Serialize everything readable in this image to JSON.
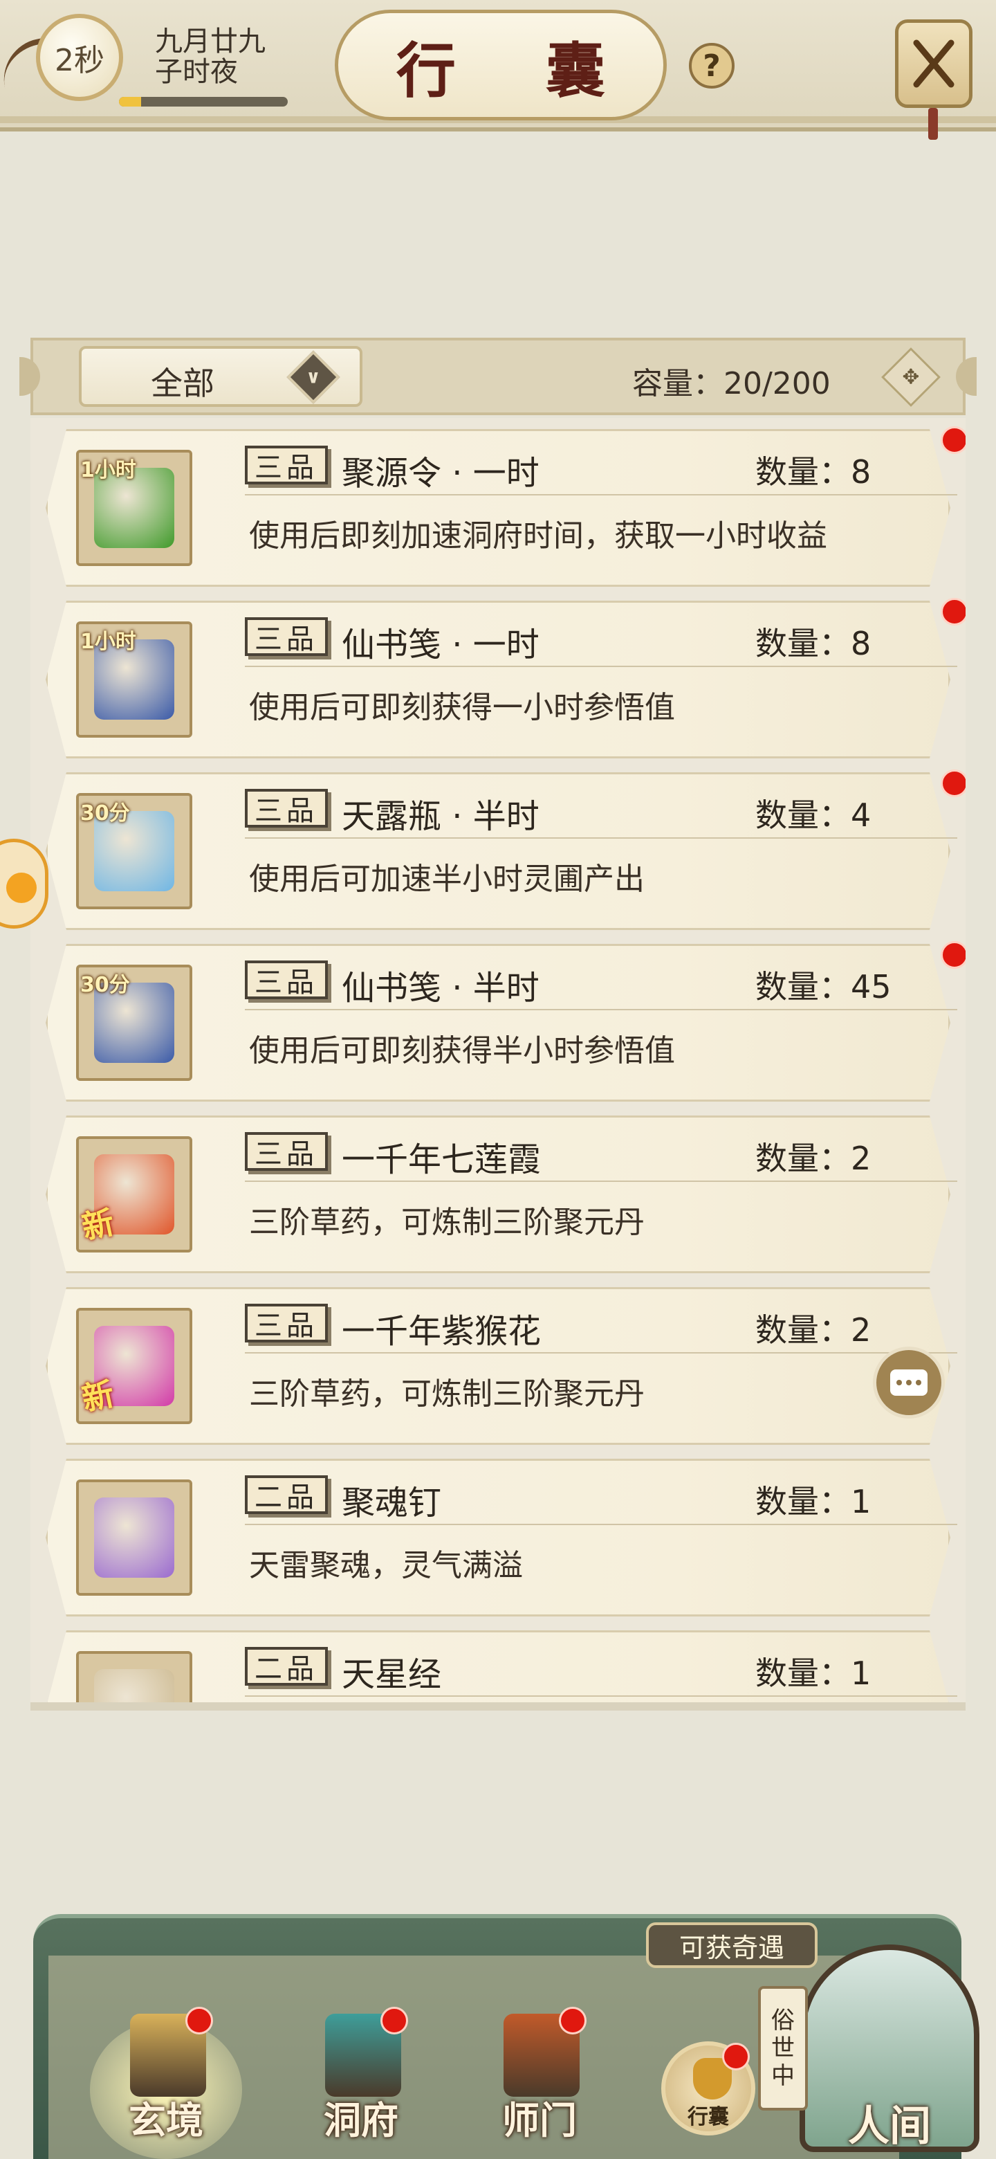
{
  "header": {
    "timer": "2秒",
    "date_line1": "九月廿九",
    "date_line2": "子时夜",
    "time_progress": 0.13,
    "title": "行 囊",
    "help": "?"
  },
  "filter": {
    "category": "全部",
    "capacity": "容量：20/200"
  },
  "items": [
    {
      "tag": "1小时",
      "grade": "三品",
      "name": "聚源令 · 一时",
      "qty": "数量：8",
      "desc": "使用后即刻加速洞府时间，获取一小时收益",
      "art": "green-token-icon",
      "art_color": "#3f9a2a",
      "new": "",
      "dot": true
    },
    {
      "tag": "1小时",
      "grade": "三品",
      "name": "仙书笺 · 一时",
      "qty": "数量：8",
      "desc": "使用后可即刻获得一小时参悟值",
      "art": "scroll-book-icon",
      "art_color": "#3a5aa8",
      "new": "",
      "dot": true
    },
    {
      "tag": "30分",
      "grade": "三品",
      "name": "天露瓶 · 半时",
      "qty": "数量：4",
      "desc": "使用后可加速半小时灵圃产出",
      "art": "dew-vase-icon",
      "art_color": "#6fb6e4",
      "new": "",
      "dot": true
    },
    {
      "tag": "30分",
      "grade": "三品",
      "name": "仙书笺 · 半时",
      "qty": "数量：45",
      "desc": "使用后可即刻获得半小时参悟值",
      "art": "scroll-book-icon",
      "art_color": "#3a5aa8",
      "new": "",
      "dot": true
    },
    {
      "tag": "",
      "grade": "三品",
      "name": "一千年七莲霞",
      "qty": "数量：2",
      "desc": "三阶草药，可炼制三阶聚元丹",
      "art": "lotus-flower-icon",
      "art_color": "#e0552a",
      "new": "新",
      "dot": false
    },
    {
      "tag": "",
      "grade": "三品",
      "name": "一千年紫猴花",
      "qty": "数量：2",
      "desc": "三阶草药，可炼制三阶聚元丹",
      "art": "purple-flower-icon",
      "art_color": "#d23aa8",
      "new": "新",
      "dot": false
    },
    {
      "tag": "",
      "grade": "二品",
      "name": "聚魂钉",
      "qty": "数量：1",
      "desc": "天雷聚魂，灵气满溢",
      "art": "soul-nail-icon",
      "art_color": "#9a6ad0",
      "new": "",
      "dot": false
    },
    {
      "tag": "",
      "grade": "二品",
      "name": "天星经",
      "qty": "数量：1",
      "desc": "",
      "art": "sutra-scroll-icon",
      "art_color": "#c9b58a",
      "new": "",
      "dot": false
    }
  ],
  "bottom_nav": {
    "encounter": "可获奇遇",
    "items": [
      {
        "label": "玄境",
        "icon": "scroll-realm-icon",
        "color": "#d9b25a",
        "dot": true
      },
      {
        "label": "洞府",
        "icon": "pavilion-icon",
        "color": "#3e9e9a",
        "dot": true
      },
      {
        "label": "师门",
        "icon": "sect-banner-icon",
        "color": "#c25a2a",
        "dot": true
      }
    ],
    "pouch_label": "行囊",
    "world_scroll_1": "俗",
    "world_scroll_2": "世",
    "world_scroll_3": "中",
    "world_label": "人间"
  }
}
